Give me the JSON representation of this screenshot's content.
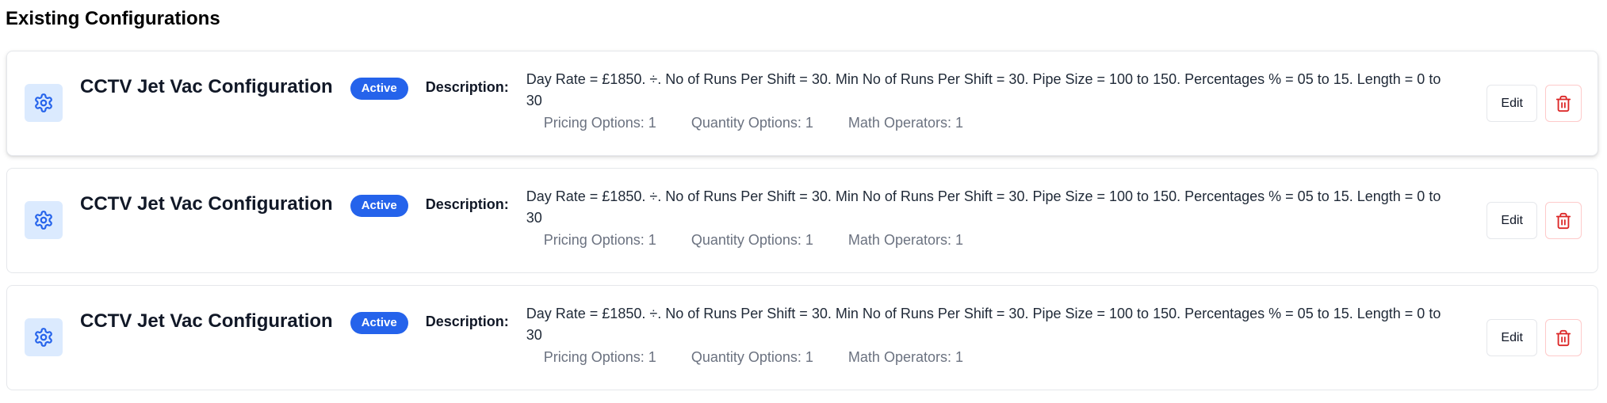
{
  "section": {
    "title": "Existing Configurations"
  },
  "colors": {
    "accent": "#2563eb",
    "icon_bg": "#dbeafe",
    "danger": "#dc2626",
    "muted_text": "#6b7280"
  },
  "configurations": [
    {
      "icon": "gear-icon",
      "name": "CCTV Jet Vac Configuration",
      "status": "Active",
      "description_label": "Description:",
      "description": "Day Rate = £1850. ÷. No of Runs Per Shift = 30. Min No of Runs Per Shift = 30. Pipe Size = 100 to 150. Percentages % = 05 to 15. Length = 0 to 30",
      "stats": {
        "pricing": "Pricing Options: 1",
        "quantity": "Quantity Options: 1",
        "math": "Math Operators: 1"
      },
      "edit_label": "Edit",
      "delete_icon": "trash-icon"
    },
    {
      "icon": "gear-icon",
      "name": "CCTV Jet Vac Configuration",
      "status": "Active",
      "description_label": "Description:",
      "description": "Day Rate = £1850. ÷. No of Runs Per Shift = 30. Min No of Runs Per Shift = 30. Pipe Size = 100 to 150. Percentages % = 05 to 15. Length = 0 to 30",
      "stats": {
        "pricing": "Pricing Options: 1",
        "quantity": "Quantity Options: 1",
        "math": "Math Operators: 1"
      },
      "edit_label": "Edit",
      "delete_icon": "trash-icon"
    },
    {
      "icon": "gear-icon",
      "name": "CCTV Jet Vac Configuration",
      "status": "Active",
      "description_label": "Description:",
      "description": "Day Rate = £1850. ÷. No of Runs Per Shift = 30. Min No of Runs Per Shift = 30. Pipe Size = 100 to 150. Percentages % = 05 to 15. Length = 0 to 30",
      "stats": {
        "pricing": "Pricing Options: 1",
        "quantity": "Quantity Options: 1",
        "math": "Math Operators: 1"
      },
      "edit_label": "Edit",
      "delete_icon": "trash-icon"
    }
  ]
}
